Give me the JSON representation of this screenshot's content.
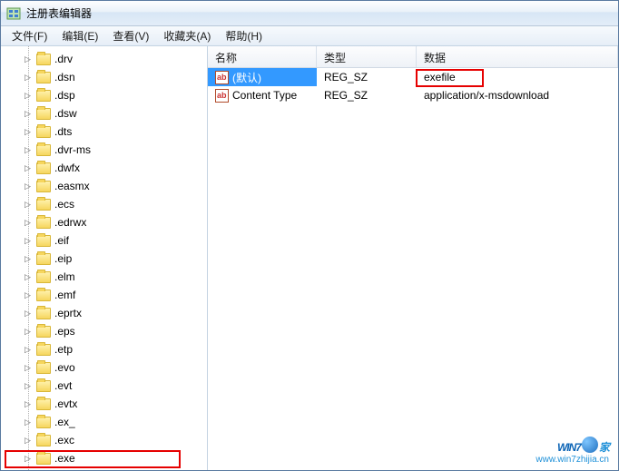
{
  "window": {
    "title": "注册表编辑器"
  },
  "menu": {
    "file": "文件(F)",
    "edit": "编辑(E)",
    "view": "查看(V)",
    "favorites": "收藏夹(A)",
    "help": "帮助(H)"
  },
  "tree": [
    ".drv",
    ".dsn",
    ".dsp",
    ".dsw",
    ".dts",
    ".dvr-ms",
    ".dwfx",
    ".easmx",
    ".ecs",
    ".edrwx",
    ".eif",
    ".eip",
    ".elm",
    ".emf",
    ".eprtx",
    ".eps",
    ".etp",
    ".evo",
    ".evt",
    ".evtx",
    ".ex_",
    ".exc",
    ".exe"
  ],
  "list": {
    "headers": {
      "name": "名称",
      "type": "类型",
      "data": "数据"
    },
    "rows": [
      {
        "name": "(默认)",
        "type": "REG_SZ",
        "data": "exefile",
        "selected": true
      },
      {
        "name": "Content Type",
        "type": "REG_SZ",
        "data": "application/x-msdownload",
        "selected": false
      }
    ]
  },
  "watermark": {
    "brand_prefix": "W",
    "brand_in": "IN",
    "brand_seven": "7",
    "brand_suffix": "家",
    "url": "www.win7zhijia.cn"
  }
}
